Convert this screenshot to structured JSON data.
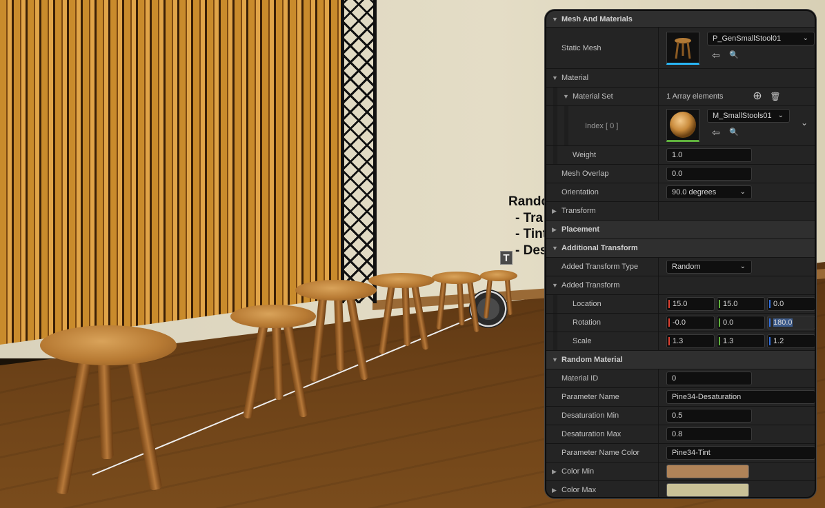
{
  "viewport": {
    "overlay_text": [
      "Rando",
      "- Tra",
      "- Tint",
      "- Des"
    ],
    "text_actor_icon": "T"
  },
  "details": {
    "mesh_and_materials": {
      "header": "Mesh And Materials",
      "static_mesh_label": "Static Mesh",
      "static_mesh_value": "P_GenSmallStool01"
    },
    "material": {
      "header": "Material",
      "material_set_label": "Material Set",
      "array_count": "1 Array elements",
      "index_label": "Index [ 0 ]",
      "material_value": "M_SmallStools01",
      "weight_label": "Weight",
      "weight_value": "1.0"
    },
    "mesh_overlap": {
      "label": "Mesh Overlap",
      "value": "0.0"
    },
    "orientation": {
      "label": "Orientation",
      "value": "90.0 degrees"
    },
    "transform": {
      "label": "Transform"
    },
    "placement": {
      "label": "Placement"
    },
    "additional_transform": {
      "header": "Additional Transform",
      "type_label": "Added Transform  Type",
      "type_value": "Random",
      "sub_header": "Added Transform",
      "location": {
        "label": "Location",
        "x": "15.0",
        "y": "15.0",
        "z": "0.0"
      },
      "rotation": {
        "label": "Rotation",
        "x": "-0.0",
        "y": "0.0",
        "z": "180.0"
      },
      "scale": {
        "label": "Scale",
        "x": "1.3",
        "y": "1.3",
        "z": "1.2"
      }
    },
    "random_material": {
      "header": "Random Material",
      "material_id_label": "Material ID",
      "material_id_value": "0",
      "param_name_label": "Parameter Name",
      "param_name_value": "Pine34-Desaturation",
      "desat_min_label": "Desaturation Min",
      "desat_min_value": "0.5",
      "desat_max_label": "Desaturation Max",
      "desat_max_value": "0.8",
      "param_color_label": "Parameter Name Color",
      "param_color_value": "Pine34-Tint",
      "color_min_label": "Color Min",
      "color_min": "#b08358",
      "color_max_label": "Color Max",
      "color_max": "#c9c197"
    }
  },
  "icons": {
    "expand": "▼",
    "collapse": "▶",
    "chevron": "⌄",
    "use_selected": "⇦",
    "browse": "🔍",
    "add": "⊕",
    "delete": "🗑"
  }
}
